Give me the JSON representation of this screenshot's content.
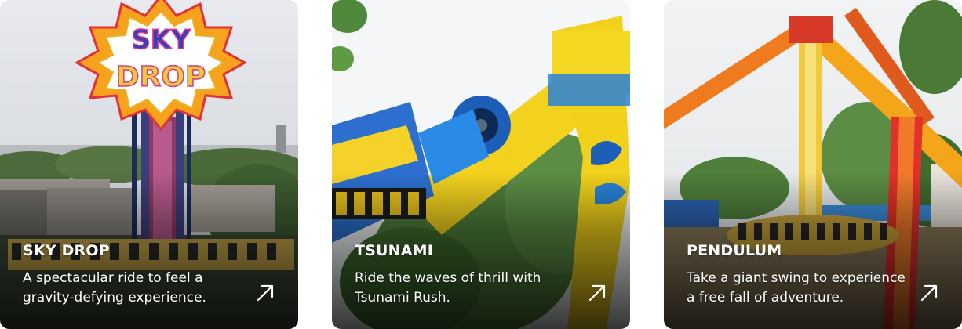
{
  "cards": [
    {
      "title": "SKY DROP",
      "description": "A spectacular ride to feel a gravity-defying experience.",
      "sign_text": "SKY DROP"
    },
    {
      "title": "TSUNAMI",
      "description": "Ride the waves of thrill with Tsunami Rush."
    },
    {
      "title": "PENDULUM",
      "description": "Take a giant swing to experience a free fall of adventure."
    }
  ],
  "icons": {
    "link_arrow": "arrow-up-right-icon"
  },
  "colors": {
    "text": "#ffffff",
    "card_radius_bg": "#000000"
  }
}
